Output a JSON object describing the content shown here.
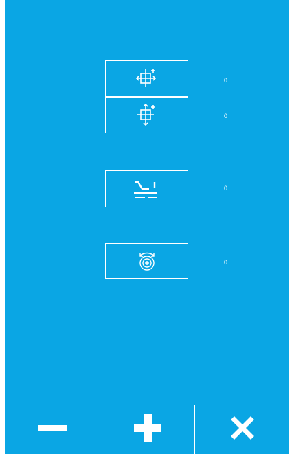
{
  "colors": {
    "background": "#0aa6e4",
    "foreground": "#ffffff"
  },
  "params": [
    {
      "icon": "move-horizontal-icon",
      "value": "0"
    },
    {
      "icon": "move-vertical-icon",
      "value": "0"
    },
    {
      "icon": "presser-foot-icon",
      "value": "0"
    },
    {
      "icon": "rotation-dial-icon",
      "value": "0"
    }
  ],
  "toolbar": [
    {
      "icon": "minus-icon"
    },
    {
      "icon": "plus-icon"
    },
    {
      "icon": "close-icon"
    }
  ]
}
